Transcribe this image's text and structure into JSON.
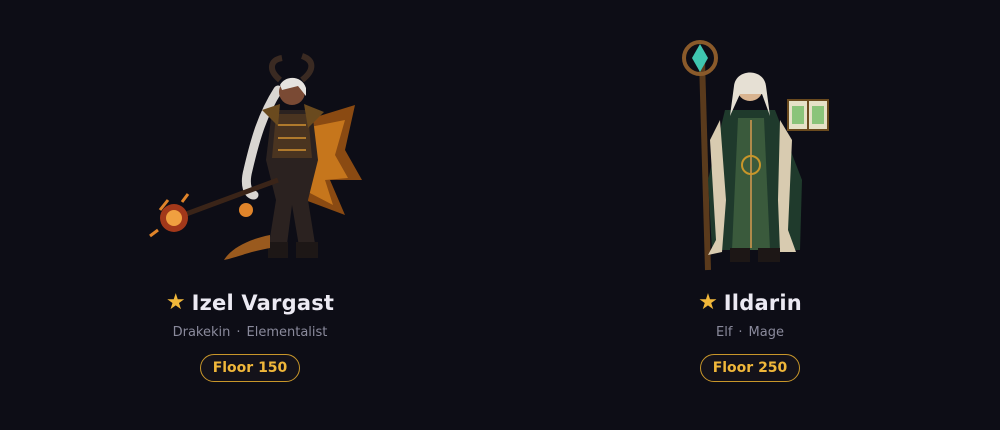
{
  "characters": [
    {
      "name": "Izel Vargast",
      "race": "Drakekin",
      "separator": "·",
      "class": "Elementalist",
      "floor": "Floor 150",
      "sprite_icon": "drakekin-elementalist-sprite"
    },
    {
      "name": "Ildarin",
      "race": "Elf",
      "separator": "·",
      "class": "Mage",
      "floor": "Floor 250",
      "sprite_icon": "elf-mage-sprite"
    }
  ],
  "colors": {
    "background": "#0d0d16",
    "star": "#f0b73a",
    "name": "#eceaf3",
    "subtitle": "#8a8a9c",
    "badge_border": "#c8962a",
    "badge_text": "#f0b73a"
  },
  "icons": {
    "favorite": "star-icon"
  }
}
